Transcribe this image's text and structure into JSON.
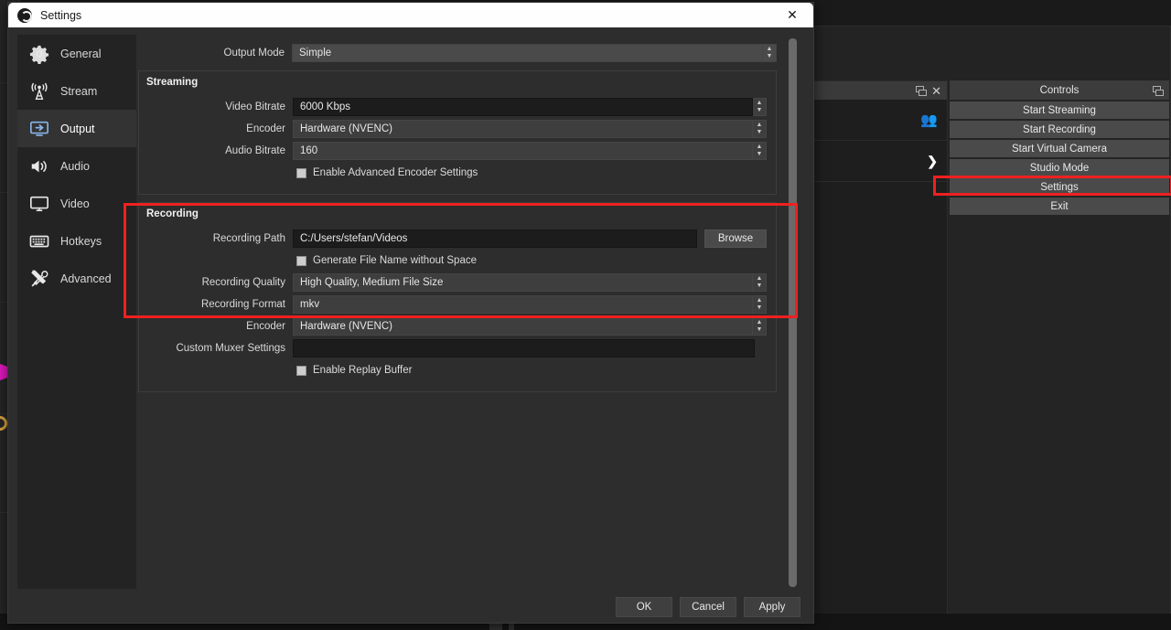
{
  "background": {
    "dock": {
      "people_icon": "people-icon",
      "chevron_icon": "chevron-right-icon",
      "float_icon": "undock-icon",
      "close_icon": "close-icon"
    }
  },
  "controls_dock": {
    "title": "Controls",
    "float_icon": "undock-icon",
    "buttons": [
      {
        "label": "Start Streaming",
        "name": "start-streaming-button"
      },
      {
        "label": "Start Recording",
        "name": "start-recording-button"
      },
      {
        "label": "Start Virtual Camera",
        "name": "start-virtual-camera-button"
      },
      {
        "label": "Studio Mode",
        "name": "studio-mode-button"
      },
      {
        "label": "Settings",
        "name": "settings-button"
      },
      {
        "label": "Exit",
        "name": "exit-button"
      }
    ],
    "highlighted_button": "Settings"
  },
  "dialog": {
    "title": "Settings",
    "logo_icon": "obs-logo-icon",
    "close_icon": "close-icon",
    "sidebar": {
      "items": [
        {
          "label": "General",
          "icon": "gear-icon",
          "selected": false
        },
        {
          "label": "Stream",
          "icon": "broadcast-icon",
          "selected": false
        },
        {
          "label": "Output",
          "icon": "output-icon",
          "selected": true
        },
        {
          "label": "Audio",
          "icon": "speaker-icon",
          "selected": false
        },
        {
          "label": "Video",
          "icon": "monitor-icon",
          "selected": false
        },
        {
          "label": "Hotkeys",
          "icon": "keyboard-icon",
          "selected": false
        },
        {
          "label": "Advanced",
          "icon": "tools-icon",
          "selected": false
        }
      ]
    },
    "output_mode": {
      "label": "Output Mode",
      "value": "Simple"
    },
    "streaming": {
      "group_title": "Streaming",
      "video_bitrate": {
        "label": "Video Bitrate",
        "value": "6000 Kbps"
      },
      "encoder": {
        "label": "Encoder",
        "value": "Hardware (NVENC)"
      },
      "audio_bitrate": {
        "label": "Audio Bitrate",
        "value": "160"
      },
      "advanced_encoder": {
        "label": "Enable Advanced Encoder Settings",
        "checked": false
      }
    },
    "recording": {
      "group_title": "Recording",
      "highlighted": true,
      "recording_path": {
        "label": "Recording Path",
        "value": "C:/Users/stefan/Videos"
      },
      "browse_label": "Browse",
      "generate_file_name": {
        "label": "Generate File Name without Space",
        "checked": false
      },
      "recording_quality": {
        "label": "Recording Quality",
        "value": "High Quality, Medium File Size"
      },
      "recording_format": {
        "label": "Recording Format",
        "value": "mkv"
      },
      "encoder": {
        "label": "Encoder",
        "value": "Hardware (NVENC)"
      },
      "custom_muxer": {
        "label": "Custom Muxer Settings",
        "value": ""
      },
      "replay_buffer": {
        "label": "Enable Replay Buffer",
        "checked": false
      }
    },
    "footer": {
      "ok": "OK",
      "cancel": "Cancel",
      "apply": "Apply"
    }
  },
  "colors": {
    "annotation": "#ef2020",
    "accent_selected_icon": "#8ab4e8",
    "dialog_bg": "#2d2d2d",
    "titlebar_bg": "#fefefe"
  }
}
